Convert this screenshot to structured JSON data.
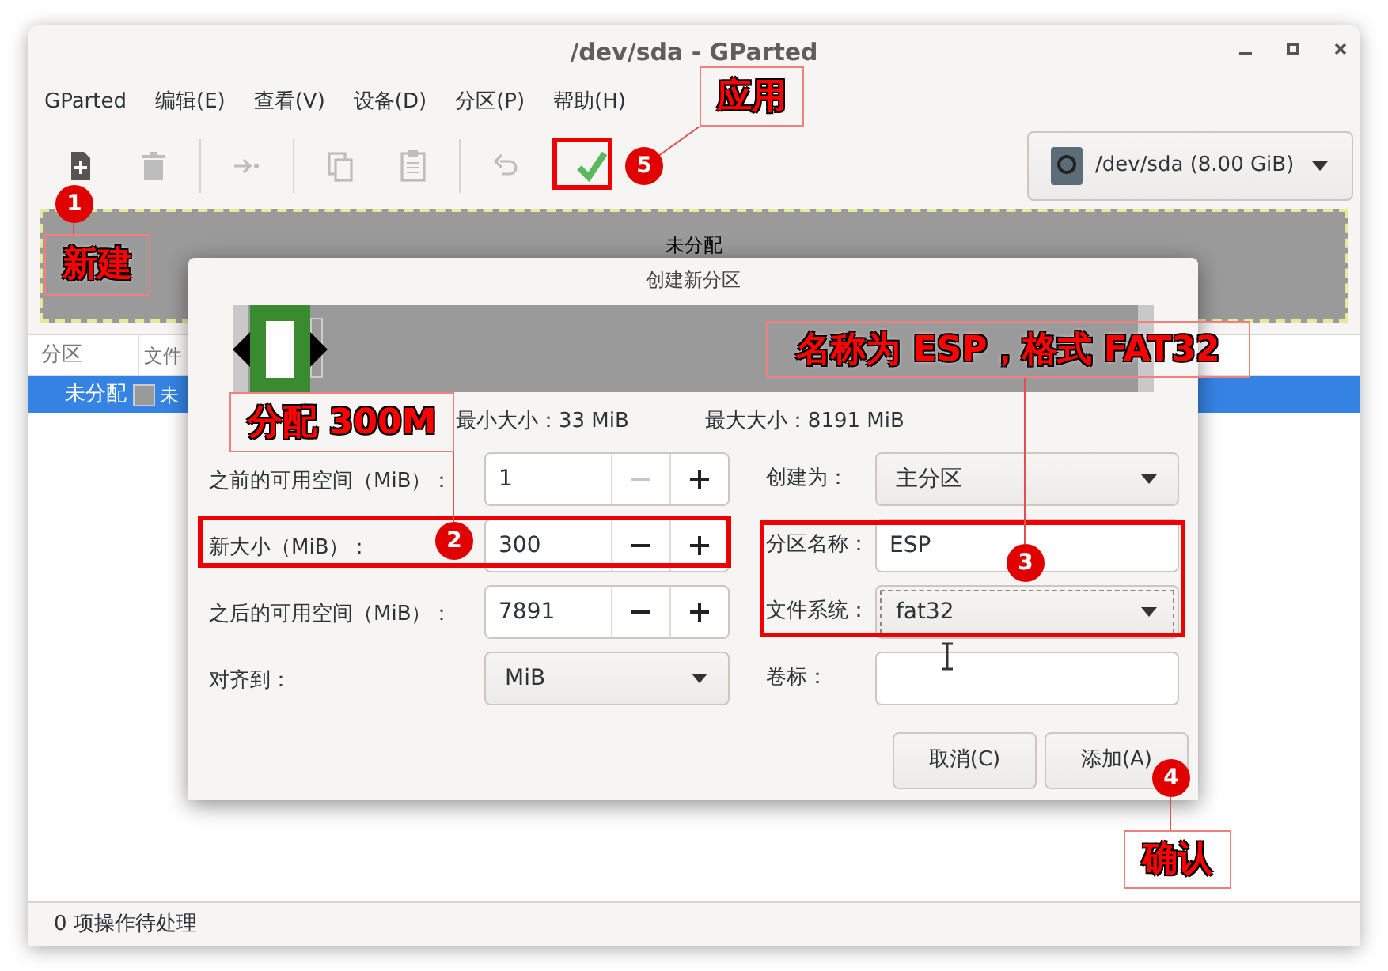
{
  "window": {
    "title": "/dev/sda - GParted"
  },
  "menu": [
    "GParted",
    "编辑(E)",
    "查看(V)",
    "设备(D)",
    "分区(P)",
    "帮助(H)"
  ],
  "toolbar": [
    {
      "kind": "new",
      "disabled": false
    },
    {
      "kind": "delete",
      "disabled": true
    },
    {
      "kind": "separator"
    },
    {
      "kind": "resize",
      "disabled": true
    },
    {
      "kind": "separator"
    },
    {
      "kind": "copy",
      "disabled": true
    },
    {
      "kind": "paste",
      "disabled": true
    },
    {
      "kind": "separator"
    },
    {
      "kind": "undo",
      "disabled": true
    },
    {
      "kind": "apply",
      "disabled": false
    }
  ],
  "device": "/dev/sda (8.00 GiB)",
  "disk_graph": {
    "label": "未分配"
  },
  "table": {
    "columns": [
      "分区",
      "文件"
    ],
    "rows": [
      {
        "cells": [
          "未分配",
          "未"
        ],
        "selected": true
      }
    ]
  },
  "status_bar": "0 项操作待处理",
  "dialog": {
    "title": "创建新分区",
    "min_size": "最小大小：33 MiB",
    "max_size": "最大大小：8191 MiB",
    "left_fields": [
      {
        "kind": "spin",
        "label": "之前的可用空间（MiB）：",
        "value": "1",
        "minus_disabled": true
      },
      {
        "kind": "spin",
        "label": "新大小（MiB）：",
        "value": "300",
        "minus_disabled": false
      },
      {
        "kind": "spin",
        "label": "之后的可用空间（MiB）：",
        "value": "7891",
        "minus_disabled": false
      },
      {
        "kind": "combo",
        "label": "对齐到：",
        "value": "MiB",
        "focused": false
      }
    ],
    "right_fields": [
      {
        "kind": "combo",
        "label": "创建为：",
        "value": "主分区",
        "focused": false
      },
      {
        "kind": "entry",
        "label": "分区名称：",
        "value": "ESP"
      },
      {
        "kind": "combo",
        "label": "文件系统：",
        "value": "fat32",
        "focused": true
      },
      {
        "kind": "entry",
        "label": "卷标："
      }
    ],
    "buttons": [
      "取消(C)",
      "添加(A)"
    ]
  },
  "annotations": [
    {
      "number": "1",
      "label": "新建"
    },
    {
      "number": "5",
      "label": "应用"
    },
    {
      "number": "2",
      "label": "分配 300M"
    },
    {
      "number": "3",
      "label": "名称为 ESP，格式 FAT32"
    },
    {
      "number": "4",
      "label": "确认"
    }
  ]
}
